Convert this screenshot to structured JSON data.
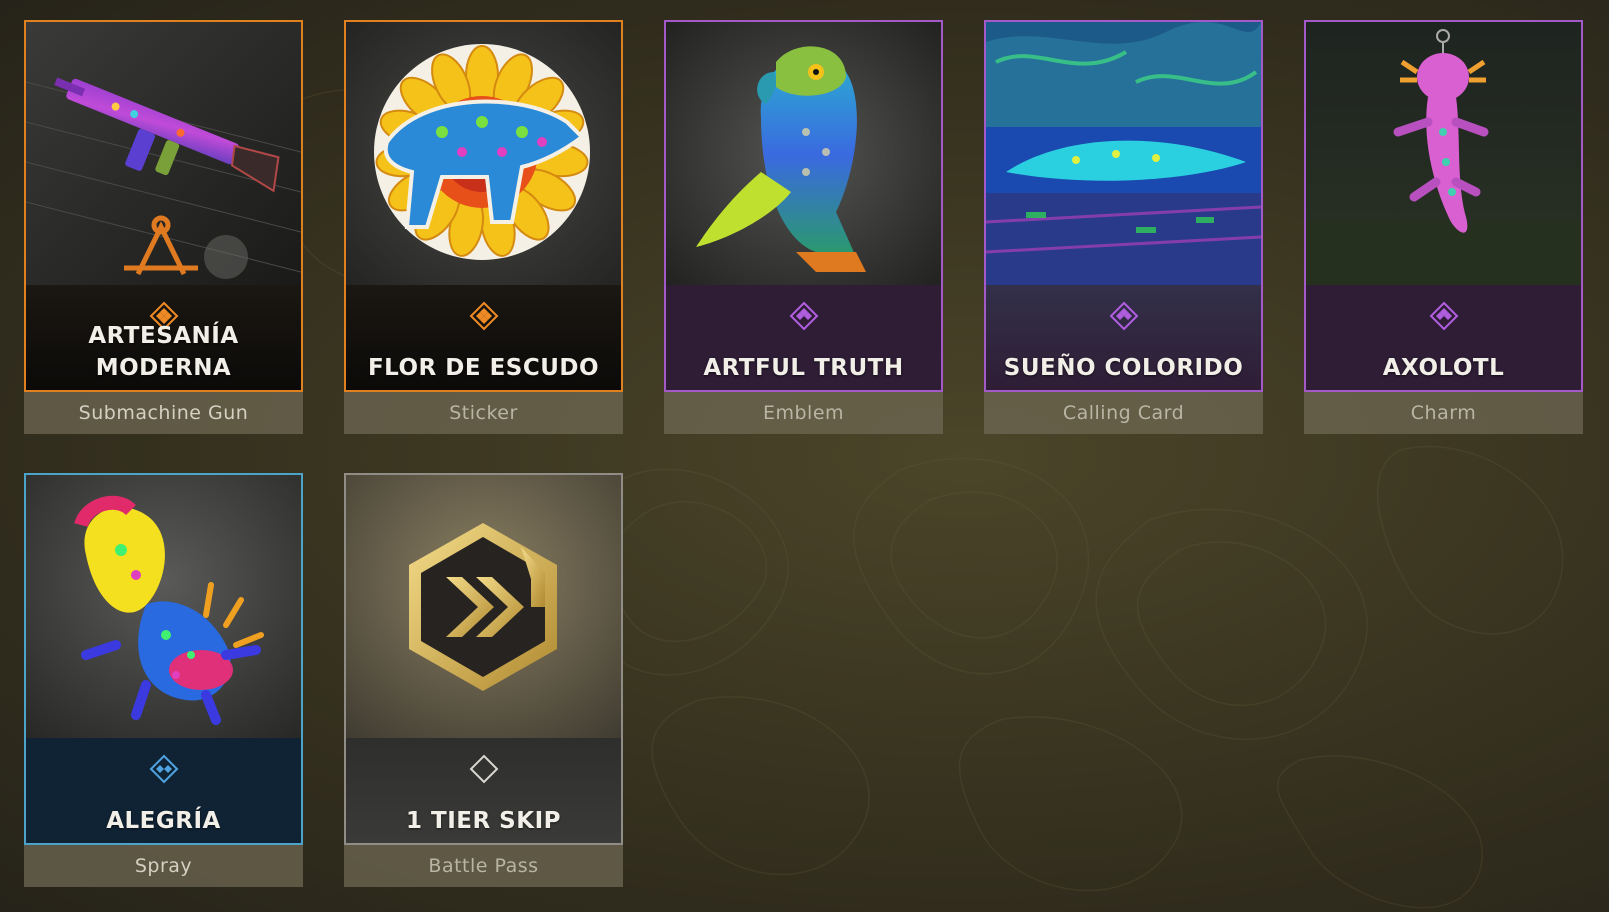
{
  "items": [
    {
      "name": "ARTESANÍA\nMODERNA",
      "type": "Submachine Gun",
      "rarity": "legendary",
      "rarity_icon": "diamond-quad-icon",
      "art_icon": "smg-weapon-icon",
      "border_color": "#e0801f"
    },
    {
      "name": "FLOR DE ESCUDO",
      "type": "Sticker",
      "rarity": "legendary",
      "rarity_icon": "diamond-quad-icon",
      "art_icon": "jaguar-sun-sticker-icon",
      "border_color": "#e0801f"
    },
    {
      "name": "ARTFUL TRUTH",
      "type": "Emblem",
      "rarity": "epic",
      "rarity_icon": "diamond-triple-icon",
      "art_icon": "parrot-emblem-icon",
      "border_color": "#a35ac8"
    },
    {
      "name": "SUEÑO COLORIDO",
      "type": "Calling Card",
      "rarity": "epic",
      "rarity_icon": "diamond-triple-icon",
      "art_icon": "calling-card-art-icon",
      "border_color": "#a35ac8"
    },
    {
      "name": "AXOLOTL",
      "type": "Charm",
      "rarity": "epic",
      "rarity_icon": "diamond-triple-icon",
      "art_icon": "axolotl-charm-icon",
      "border_color": "#a35ac8"
    },
    {
      "name": "ALEGRÍA",
      "type": "Spray",
      "rarity": "rare",
      "rarity_icon": "diamond-double-icon",
      "art_icon": "axolotl-spray-icon",
      "border_color": "#4ea3c9"
    },
    {
      "name": "1 TIER SKIP",
      "type": "Battle Pass",
      "rarity": "common",
      "rarity_icon": "diamond-outline-icon",
      "art_icon": "tier-skip-hexagon-icon",
      "border_color": "#8f8d86"
    }
  ]
}
